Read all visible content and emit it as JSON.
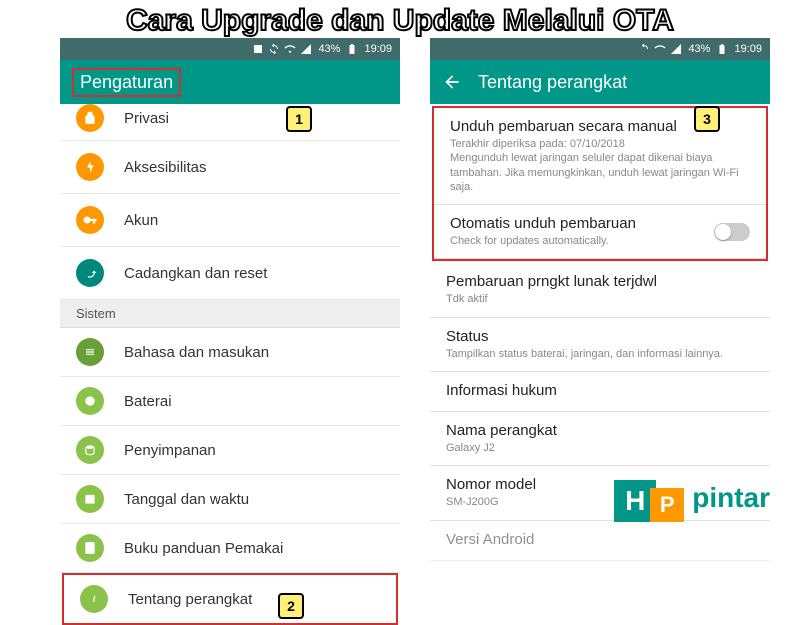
{
  "overlay": {
    "title": "Cara Upgrade dan Update Melalui OTA"
  },
  "status": {
    "battery": "43%",
    "time": "19:09"
  },
  "left": {
    "header": "Pengaturan",
    "partial_top": "Privasi",
    "items_top": [
      {
        "label": "Aksesibilitas"
      },
      {
        "label": "Akun"
      },
      {
        "label": "Cadangkan dan reset"
      }
    ],
    "section": "Sistem",
    "items_sys": [
      {
        "label": "Bahasa dan masukan"
      },
      {
        "label": "Baterai"
      },
      {
        "label": "Penyimpanan"
      },
      {
        "label": "Tanggal dan waktu"
      },
      {
        "label": "Buku panduan Pemakai"
      },
      {
        "label": "Tentang perangkat"
      }
    ]
  },
  "right": {
    "header": "Tentang perangkat",
    "manual": {
      "title": "Unduh pembaruan secara manual",
      "sub": "Terakhir diperiksa pada: 07/10/2018\nMengunduh lewat jaringan seluler dapat dikenai biaya tambahan. Jika memungkinkan, unduh lewat jaringan Wi-Fi saja."
    },
    "auto": {
      "title": "Otomatis unduh pembaruan",
      "sub": "Check for updates automatically."
    },
    "items": [
      {
        "title": "Pembaruan prngkt lunak terjdwl",
        "sub": "Tdk aktif"
      },
      {
        "title": "Status",
        "sub": "Tampilkan status baterai, jaringan, dan informasi lainnya."
      },
      {
        "title": "Informasi hukum",
        "sub": ""
      },
      {
        "title": "Nama perangkat",
        "sub": "Galaxy J2"
      },
      {
        "title": "Nomor model",
        "sub": "SM-J200G"
      },
      {
        "title": "Versi Android",
        "sub": ""
      }
    ]
  },
  "badges": {
    "b1": "1",
    "b2": "2",
    "b3": "3"
  },
  "logo": {
    "h": "H",
    "p": "P",
    "text": "pintar"
  }
}
